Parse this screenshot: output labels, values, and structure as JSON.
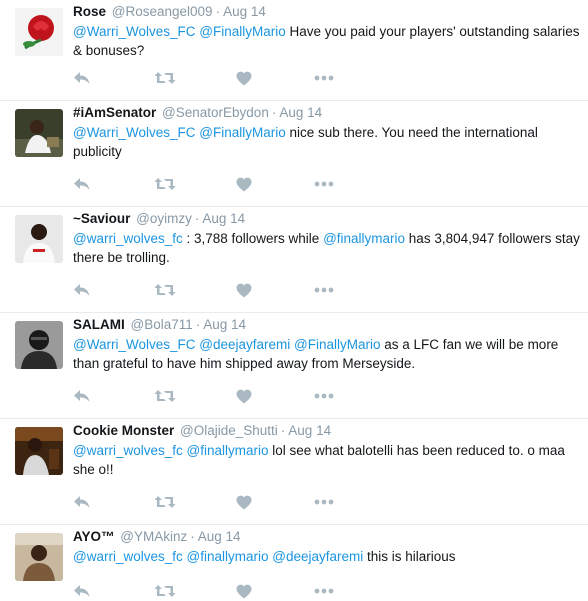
{
  "colors": {
    "mention": "#1b95e0",
    "meta": "#8899a6",
    "icon": "#aab8c2",
    "divider": "#e6ecf0"
  },
  "tweets": [
    {
      "name": "Rose",
      "handle": "@Roseangel009",
      "time": "Aug 14",
      "segments": [
        {
          "t": "@Warri_Wolves_FC",
          "m": true
        },
        {
          "t": " "
        },
        {
          "t": "@FinallyMario",
          "m": true
        },
        {
          "t": "  Have you paid your players' outstanding salaries & bonuses?"
        }
      ],
      "avatar": "rose-avatar"
    },
    {
      "name": "#iAmSenator",
      "handle": "@SenatorEbydon",
      "time": "Aug 14",
      "segments": [
        {
          "t": "@Warri_Wolves_FC",
          "m": true
        },
        {
          "t": " "
        },
        {
          "t": "@FinallyMario",
          "m": true
        },
        {
          "t": " nice sub there. You need the international publicity"
        }
      ],
      "avatar": "senator-avatar"
    },
    {
      "name": "~Saviour",
      "handle": "@oyimzy",
      "time": "Aug 14",
      "segments": [
        {
          "t": "@warri_wolves_fc",
          "m": true
        },
        {
          "t": " : 3,788 followers while "
        },
        {
          "t": "@finallymario",
          "m": true
        },
        {
          "t": " has 3,804,947 followers stay there be trolling."
        }
      ],
      "avatar": "saviour-avatar"
    },
    {
      "name": "SALAMI",
      "handle": "@Bola711",
      "time": "Aug 14",
      "segments": [
        {
          "t": "@Warri_Wolves_FC",
          "m": true
        },
        {
          "t": " "
        },
        {
          "t": "@deejayfaremi",
          "m": true
        },
        {
          "t": " "
        },
        {
          "t": "@FinallyMario",
          "m": true
        },
        {
          "t": " as a LFC fan we will be more than grateful to have him shipped away from Merseyside."
        }
      ],
      "avatar": "salami-avatar"
    },
    {
      "name": "Cookie Monster",
      "handle": "@Olajide_Shutti",
      "time": "Aug 14",
      "segments": [
        {
          "t": "@warri_wolves_fc",
          "m": true
        },
        {
          "t": " "
        },
        {
          "t": "@finallymario",
          "m": true
        },
        {
          "t": " lol see what balotelli has been reduced to. o maa she o!!"
        }
      ],
      "avatar": "cookie-avatar"
    },
    {
      "name": "AYO™",
      "handle": "@YMAkinz",
      "time": "Aug 14",
      "segments": [
        {
          "t": "@warri_wolves_fc",
          "m": true
        },
        {
          "t": " "
        },
        {
          "t": "@finallymario",
          "m": true
        },
        {
          "t": " "
        },
        {
          "t": "@deejayfaremi",
          "m": true
        },
        {
          "t": " this is hilarious"
        }
      ],
      "avatar": "ayo-avatar"
    }
  ]
}
